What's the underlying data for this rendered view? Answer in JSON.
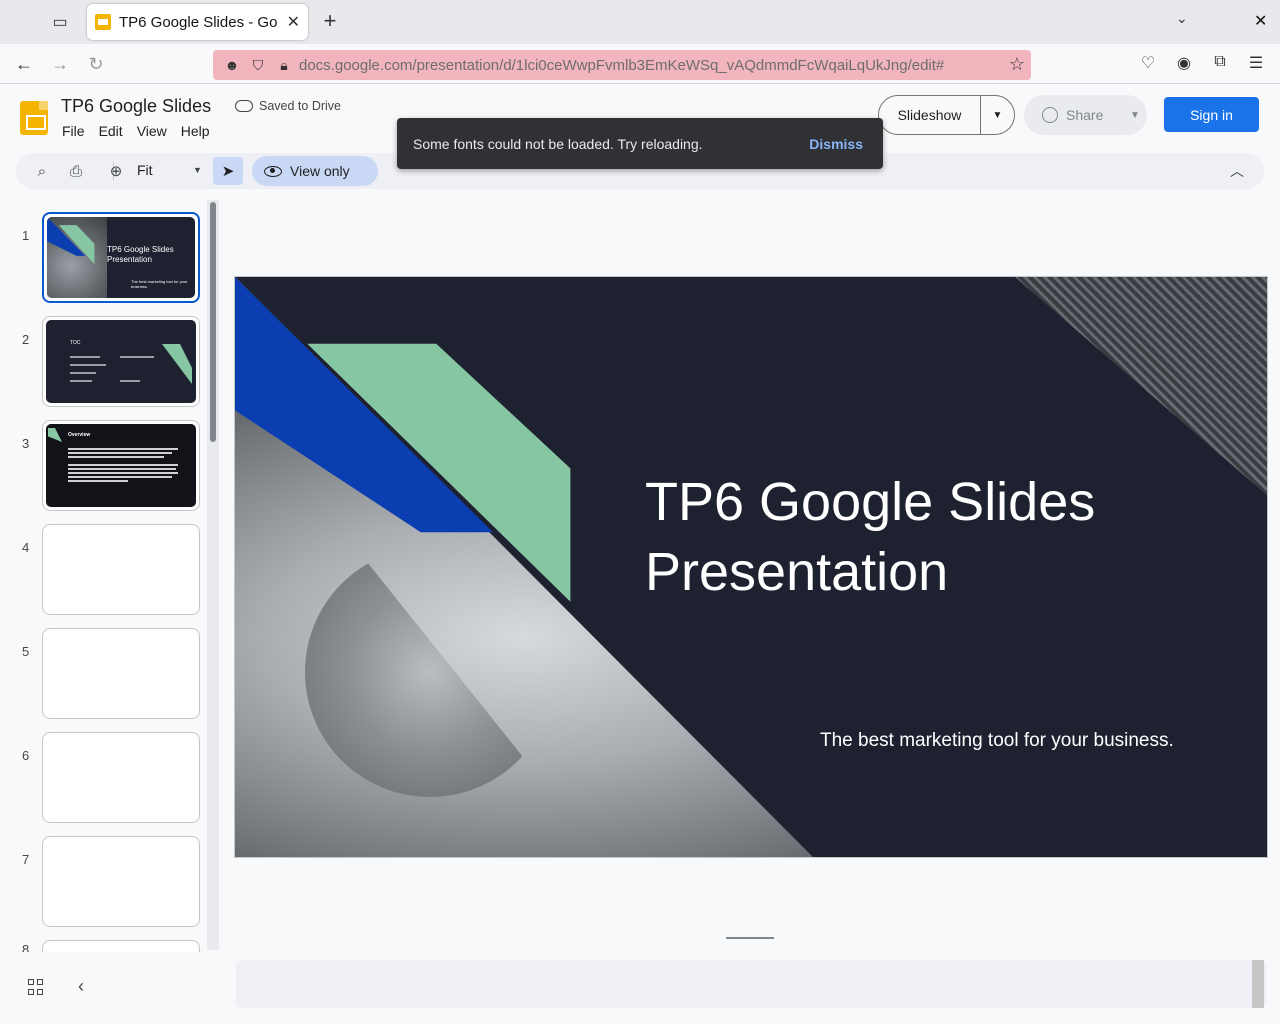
{
  "browser": {
    "tab_title": "TP6 Google Slides - Go",
    "url": "docs.google.com/presentation/d/1lci0ceWwpFvmlb3EmKeWSq_vAQdmmdFcWqaiLqUkJng/edit#"
  },
  "header": {
    "doc_title": "TP6 Google Slides",
    "saved_status": "Saved to Drive",
    "menu": [
      "File",
      "Edit",
      "View",
      "Help"
    ],
    "slideshow_label": "Slideshow",
    "share_label": "Share",
    "signin_label": "Sign in"
  },
  "toolbar": {
    "zoom_value": "Fit",
    "view_mode_label": "View only"
  },
  "toast": {
    "message": "Some fonts could not be loaded. Try reloading.",
    "dismiss_label": "Dismiss"
  },
  "filmstrip": {
    "slide_numbers": [
      "1",
      "2",
      "3",
      "4",
      "5",
      "6",
      "7",
      "8"
    ],
    "thumb1": {
      "title": "TP6 Google Slides Presentation",
      "subtitle": "The best marketing tool for your business."
    },
    "thumb2": {
      "label": "TOC"
    },
    "thumb3": {
      "label": "Overview"
    }
  },
  "slide": {
    "title_line1": "TP6 Google Slides",
    "title_line2": "Presentation",
    "subtitle": "The best marketing tool for your business."
  },
  "colors": {
    "slide_background": "#1e2130",
    "accent_blue": "#0b3eb0",
    "accent_green": "#86c6a2",
    "signin_blue": "#1a73e8",
    "url_bar_privacy": "#f2b5bd"
  }
}
